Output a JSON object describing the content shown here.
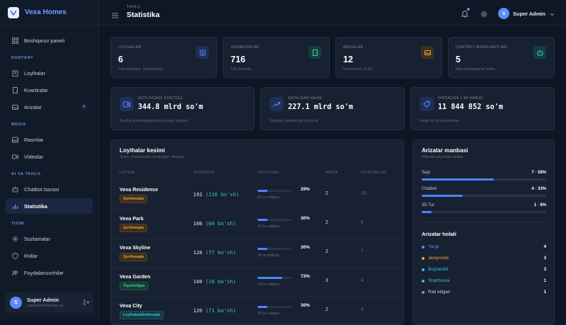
{
  "brand": {
    "name": "Vexa Homes"
  },
  "sidebar": {
    "top_item": {
      "label": "Boshqaruv paneli",
      "icon": "dashboard-icon"
    },
    "sections": [
      {
        "title": "KONTENT",
        "items": [
          {
            "label": "Loyihalar",
            "icon": "building-icon"
          },
          {
            "label": "Kvartiralar",
            "icon": "door-icon"
          },
          {
            "label": "Arizalar",
            "icon": "inbox-icon",
            "badge": "4"
          }
        ]
      },
      {
        "title": "MEDIA",
        "items": [
          {
            "label": "Rasmlar",
            "icon": "image-icon"
          },
          {
            "label": "Videolar",
            "icon": "video-icon"
          }
        ]
      },
      {
        "title": "AI VA TAHLIL",
        "items": [
          {
            "label": "Chatbot bazasi",
            "icon": "bot-icon"
          },
          {
            "label": "Statistika",
            "icon": "chart-icon",
            "active": true
          }
        ]
      },
      {
        "title": "TIZIM",
        "items": [
          {
            "label": "Sozlamalar",
            "icon": "gear-icon"
          },
          {
            "label": "Rollar",
            "icon": "shield-icon"
          },
          {
            "label": "Foydalanuvchilar",
            "icon": "users-icon"
          }
        ]
      }
    ],
    "user": {
      "initial": "S",
      "name": "Super Admin",
      "email": "superadmin@vexa.uz"
    }
  },
  "topbar": {
    "breadcrumb": "TAHLIL",
    "title": "Statistika",
    "user_initial": "S",
    "user_name": "Super Admin"
  },
  "stats": [
    {
      "label": "LOYIHALAR",
      "value": "6",
      "sub": "Faol loyihalar: (majmualar)",
      "icon": "building-icon",
      "color": "#5b8cff"
    },
    {
      "label": "XONADONLAR",
      "value": "716",
      "sub": "165 sotuvda",
      "icon": "door-icon",
      "color": "#3ecf9e"
    },
    {
      "label": "ARIZALAR",
      "value": "12",
      "sub": "Konversiya: 8.3%",
      "icon": "inbox-icon",
      "color": "#f0a43c"
    },
    {
      "label": "CHATBOT MUROJAATLARI",
      "value": "5",
      "sub": "Bitta bazadagi bo'yicha",
      "icon": "bot-icon",
      "color": "#2ec7d6"
    }
  ],
  "kpis": [
    {
      "label": "SOTUVDAGI PORTFEL",
      "value": "344.8 mlrd so'm",
      "sub": "Barcha sotuvdagilarning umumiy qiymati",
      "icon": "wallet-icon",
      "color": "#5b8cff"
    },
    {
      "label": "SOTILGAN HAJM",
      "value": "227.1 mlrd so'm",
      "sub": "Sotilgan xonadonlar bo'yicha",
      "icon": "trend-up-icon",
      "color": "#5b8cff"
    },
    {
      "label": "O'RTACHA 1 M² NARXI",
      "value": "11 844 852 so'm",
      "sub": "Faqat bo'sh xonadonlar",
      "icon": "tag-icon",
      "color": "#5b8cff"
    }
  ],
  "projects": {
    "title": "Loyihalar kesimi",
    "subtitle": "Sotuv, zhavobudar va qiziqish darajasi",
    "headers": [
      "LOYIHA",
      "XONADON",
      "SOTILGAN",
      "ARIZA",
      "KO'RISHLAR"
    ],
    "rows": [
      {
        "name": "Vexa Residence",
        "status": "Qurilmoqda",
        "status_color": "#f0a43c",
        "total": "192",
        "free": "(116 bo'sh)",
        "sold_pct": 29,
        "pct_label": "29%",
        "sold_text": "56 ta sotilgan",
        "requests": "2",
        "views": "10"
      },
      {
        "name": "Vexa Park",
        "status": "Qurilmoqda",
        "status_color": "#f0a43c",
        "total": "108",
        "free": "(64 bo'sh)",
        "sold_pct": 30,
        "pct_label": "30%",
        "sold_text": "32 ta sotilgan",
        "requests": "2",
        "views": "8"
      },
      {
        "name": "Vexa Skyline",
        "status": "Qurilmoqda",
        "status_color": "#f0a43c",
        "total": "128",
        "free": "(77 bo'sh)",
        "sold_pct": 30,
        "pct_label": "30%",
        "sold_text": "38 ta sotilgan",
        "requests": "2",
        "views": "7"
      },
      {
        "name": "Vexa Garden",
        "status": "Topshirilgan",
        "status_color": "#3ecf9e",
        "total": "108",
        "free": "(16 bo'sh)",
        "sold_pct": 73,
        "pct_label": "73%",
        "sold_text": "79 ta sotilgan",
        "requests": "3",
        "views": "4"
      },
      {
        "name": "Vexa City",
        "status": "Loyihalashtirilmoqda",
        "status_color": "#2ec7d6",
        "total": "120",
        "free": "(71 bo'sh)",
        "sold_pct": 30,
        "pct_label": "30%",
        "sold_text": "36 ta sotilgan",
        "requests": "2",
        "views": "4"
      }
    ]
  },
  "sources": {
    "title": "Arizalar manbasi",
    "subtitle": "Mijozlar qayerdan keladi",
    "items": [
      {
        "label": "Sayt",
        "value": "7 · 58%",
        "pct": 58
      },
      {
        "label": "Chatbot",
        "value": "4 · 33%",
        "pct": 33
      },
      {
        "label": "3D Tur",
        "value": "1 · 8%",
        "pct": 8
      }
    ],
    "status_title": "Arizalar holati",
    "statuses": [
      {
        "label": "Yangi",
        "value": "4",
        "color": "#5b8cff"
      },
      {
        "label": "Jarayonda",
        "value": "3",
        "color": "#f0a43c"
      },
      {
        "label": "Bog'lanildi",
        "value": "3",
        "color": "#2ec7d6"
      },
      {
        "label": "Shartnoma",
        "value": "1",
        "color": "#3ecf9e"
      },
      {
        "label": "Rad etilgan",
        "value": "1",
        "color": "#8a94a6"
      }
    ]
  }
}
